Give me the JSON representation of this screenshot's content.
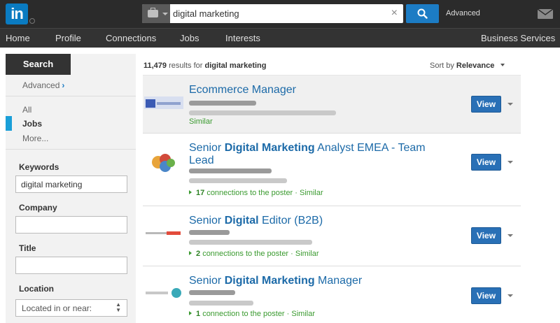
{
  "app": {
    "logo_text": "in"
  },
  "search": {
    "query": "digital marketing",
    "advanced_label": "Advanced",
    "clear_label": "×"
  },
  "nav": [
    "Home",
    "Profile",
    "Connections",
    "Jobs",
    "Interests"
  ],
  "nav_right": "Business Services",
  "sidebar": {
    "search_tab": "Search",
    "advanced_link": "Advanced",
    "types": [
      "All",
      "Jobs",
      "More..."
    ],
    "filters": {
      "keywords_label": "Keywords",
      "keywords_value": "digital marketing",
      "company_label": "Company",
      "company_value": "",
      "title_label": "Title",
      "title_value": "",
      "location_label": "Location",
      "location_value": "Located in or near:"
    }
  },
  "results": {
    "count": "11,479",
    "count_suffix": "results for",
    "query": "digital marketing",
    "sort_label": "Sort by",
    "sort_value": "Relevance",
    "jobs": [
      {
        "title_parts": [
          "Ecommerce Manager"
        ],
        "connections": "",
        "connections_text": "",
        "similar": "Similar",
        "view": "View"
      },
      {
        "title_parts": [
          "Senior ",
          "Digital Marketing",
          " Analyst EMEA - Team Lead"
        ],
        "connections": "17",
        "connections_text": "connections to the poster",
        "similar": "Similar",
        "view": "View"
      },
      {
        "title_parts": [
          "Senior ",
          "Digital",
          " Editor (B2B)"
        ],
        "connections": "2",
        "connections_text": "connections to the poster",
        "similar": "Similar",
        "view": "View"
      },
      {
        "title_parts": [
          "Senior ",
          "Digital Marketing",
          " Manager"
        ],
        "connections": "1",
        "connections_text": "connection to the poster",
        "similar": "Similar",
        "view": "View"
      }
    ]
  },
  "colors": {
    "accent": "#1c7cc4",
    "link": "#1c6aa8",
    "green": "#3a9a2f",
    "topbar": "#2b2b2b"
  }
}
